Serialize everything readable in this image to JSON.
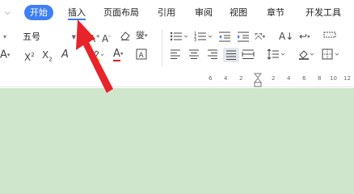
{
  "tabs": [
    {
      "label": "开始",
      "active": true
    },
    {
      "label": "插入",
      "active": false
    },
    {
      "label": "页面布局",
      "active": false
    },
    {
      "label": "引用",
      "active": false
    },
    {
      "label": "审阅",
      "active": false
    },
    {
      "label": "视图",
      "active": false
    },
    {
      "label": "章节",
      "active": false
    },
    {
      "label": "开发工具",
      "active": false
    }
  ],
  "font_size_value": "五号",
  "ruler_ticks": [
    "6",
    "4",
    "2",
    "2",
    "4",
    "6",
    "8",
    "10",
    "12"
  ],
  "colors": {
    "accent": "#3e7ff4",
    "arrow": "#e8232a",
    "doc_background": "#cfe6cc"
  }
}
